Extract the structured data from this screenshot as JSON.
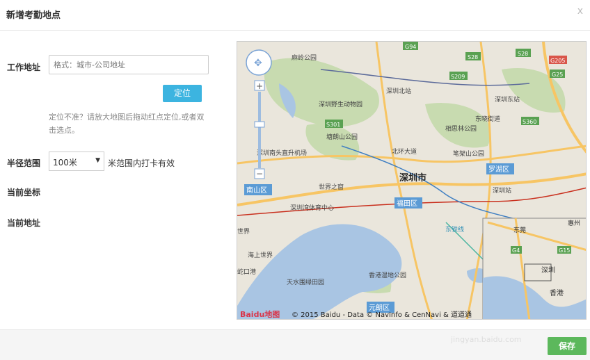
{
  "dialog": {
    "title": "新增考勤地点",
    "close_label": "x"
  },
  "form": {
    "address_label": "工作地址",
    "address_placeholder": "格式：城市-公司地址",
    "locate_button": "定位",
    "hint": "定位不准？请放大地图后拖动红点定位,或者双击选点。",
    "radius_label": "半径范围",
    "radius_value": "100米",
    "radius_note": "米范围内打卡有效",
    "coord_label": "当前坐标",
    "current_address_label": "当前地址"
  },
  "map": {
    "city_label": "深圳市",
    "places": {
      "majinglong": "麻岭公园",
      "futian_school": "深圳北站",
      "zoo": "深圳野生动物园",
      "east_station": "深圳东站",
      "dongxiao": "东晓街道",
      "xiangsi": "相思林公园",
      "tanglang": "塘朗山公园",
      "bitou": "北环大道",
      "bijiashan": "笔架山公园",
      "shenzhen_shenzhen": "深圳南头直升机场",
      "world": "世界之窗",
      "shenzhen_station": "深圳站",
      "bay_sports": "深圳湾体育中心",
      "world2": "世界",
      "haishang": "海上世界",
      "tianshui": "天水围绿田园",
      "wetland": "香港湿地公园",
      "bay_port": "蛇口港",
      "nanshan": "南山区",
      "luohu": "罗湖区",
      "futian": "福田区",
      "yuanlang": "元朗区",
      "huan": "东铁线"
    },
    "road_badges": [
      "G94",
      "S28",
      "S28",
      "G205",
      "S209",
      "G25",
      "S301",
      "S360"
    ],
    "minimap": {
      "dongguan": "东莞",
      "huizhou": "惠州",
      "shenzhen": "深圳",
      "hongkong": "香港",
      "g4": "G4",
      "g15": "G15"
    },
    "copyright": "© 2015 Baidu - Data © NavInfo & CenNavi & 道道通",
    "logo_text": "Baidu地图",
    "colors": {
      "water": "#a9c5e3",
      "land": "#eae6dc",
      "green": "#c8dbb0",
      "road_major": "#f7c564",
      "road_badge": "#5aa152",
      "district": "#5b9bd5"
    }
  },
  "footer": {
    "save_button": "保存",
    "watermark": "jingyan.baidu.com"
  }
}
